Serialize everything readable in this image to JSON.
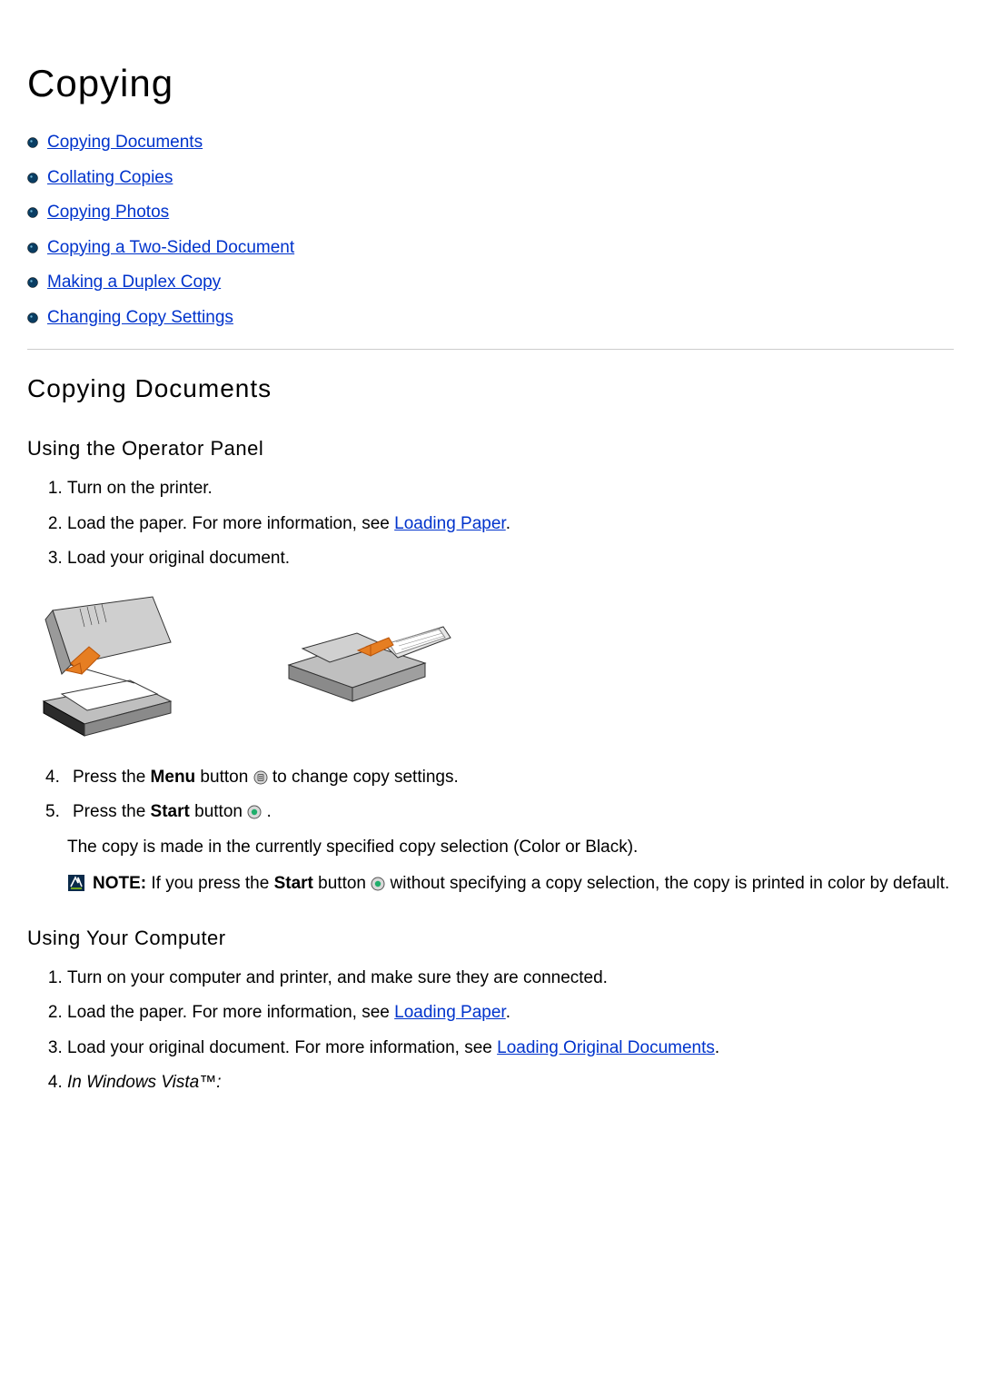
{
  "title": "Copying",
  "toc": [
    "Copying Documents",
    "Collating Copies",
    "Copying Photos",
    "Copying a Two-Sided Document",
    "Making a Duplex Copy",
    "Changing Copy Settings"
  ],
  "section1": {
    "heading": "Copying Documents",
    "sub_a_heading": "Using the Operator Panel",
    "sub_a_steps_1": "Turn on the printer.",
    "sub_a_steps_2a": "Load the paper. For more information, see ",
    "sub_a_steps_2_link": "Loading Paper",
    "sub_a_steps_2b": ".",
    "sub_a_steps_3": "Load your original document.",
    "sub_a_steps_4a": "Press the ",
    "sub_a_steps_4b": "Menu",
    "sub_a_steps_4c": " button ",
    "sub_a_steps_4d": " to change copy settings.",
    "sub_a_steps_5a": "Press the ",
    "sub_a_steps_5b": "Start",
    "sub_a_steps_5c": " button ",
    "sub_a_steps_5d": ".",
    "sub_a_body": "The copy is made in the currently specified copy selection (Color or Black).",
    "sub_a_note_a": "NOTE: ",
    "sub_a_note_b": "If you press the ",
    "sub_a_note_c": "Start",
    "sub_a_note_d": " button ",
    "sub_a_note_e": " without specifying a copy selection, the copy is printed in color by default.",
    "sub_b_heading": "Using Your Computer",
    "sub_b_steps_1": "Turn on your computer and printer, and make sure they are connected.",
    "sub_b_steps_2a": "Load the paper. For more information, see ",
    "sub_b_steps_2_link": "Loading Paper",
    "sub_b_steps_2b": ".",
    "sub_b_steps_3a": "Load your original document. For more information, see ",
    "sub_b_steps_3_link": "Loading Original Documents",
    "sub_b_steps_3b": ".",
    "sub_b_steps_4": "In Windows Vista™:"
  }
}
